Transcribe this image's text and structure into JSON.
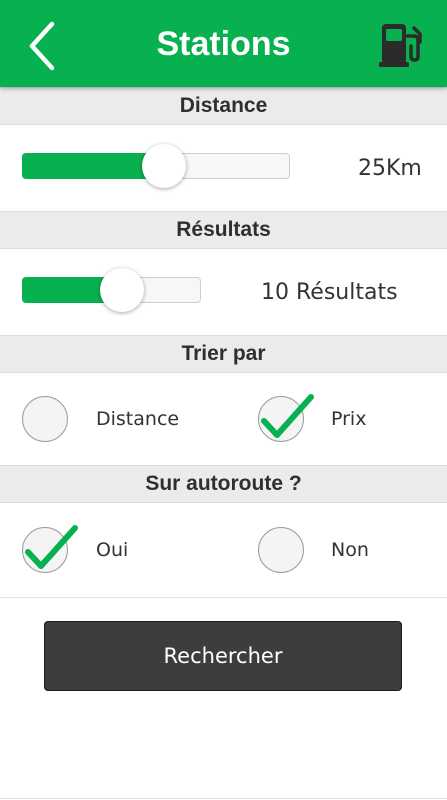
{
  "header": {
    "title": "Stations",
    "back_icon": "chevron-left-icon",
    "fuel_icon": "fuel-pump-icon",
    "color": "#08b14f"
  },
  "distance": {
    "heading": "Distance",
    "value_label": "25Km",
    "level": 0.53
  },
  "results": {
    "heading": "Résultats",
    "value_label": "10 Résultats",
    "level": 0.56
  },
  "sort": {
    "heading": "Trier par",
    "options": [
      {
        "label": "Distance",
        "checked": false
      },
      {
        "label": "Prix",
        "checked": true
      }
    ]
  },
  "highway": {
    "heading": "Sur autoroute ?",
    "options": [
      {
        "label": "Oui",
        "checked": true
      },
      {
        "label": "Non",
        "checked": false
      }
    ]
  },
  "search_button": {
    "label": "Rechercher",
    "color": "#3d3d3d"
  },
  "check_icon": "checkmark-icon",
  "check_color": "#08b14f"
}
